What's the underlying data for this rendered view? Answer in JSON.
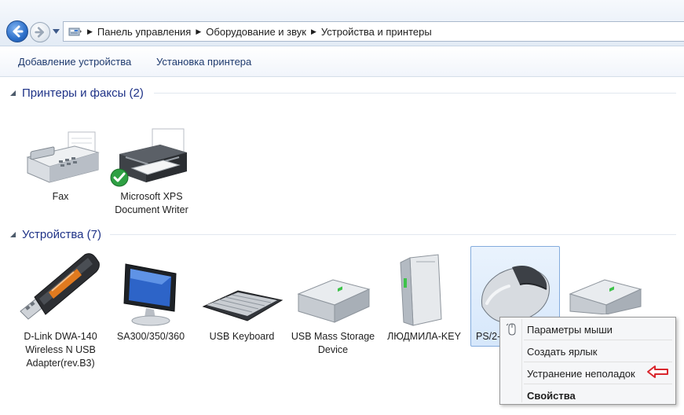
{
  "addressbar": {
    "breadcrumb": [
      {
        "label": "Панель управления"
      },
      {
        "label": "Оборудование и звук"
      },
      {
        "label": "Устройства и принтеры"
      }
    ]
  },
  "commandbar": {
    "add_device": "Добавление устройства",
    "add_printer": "Установка принтера"
  },
  "groups": {
    "printers": {
      "title": "Принтеры и факсы (2)",
      "items": [
        {
          "label": "Fax",
          "icon": "fax-icon"
        },
        {
          "label": "Microsoft XPS Document Writer",
          "icon": "printer-icon",
          "badge": "default-checkmark"
        }
      ]
    },
    "devices": {
      "title": "Устройства (7)",
      "items": [
        {
          "label": "D-Link DWA-140 Wireless N USB Adapter(rev.B3)",
          "icon": "usb-stick-icon"
        },
        {
          "label": "SA300/350/360",
          "icon": "monitor-icon"
        },
        {
          "label": "USB Keyboard",
          "icon": "keyboard-icon"
        },
        {
          "label": "USB Mass Storage Device",
          "icon": "drive-icon"
        },
        {
          "label": "ЛЮДМИЛА-KEY",
          "icon": "computer-icon"
        },
        {
          "label": "PS/2-",
          "icon": "mouse-icon",
          "selected": true
        },
        {
          "label": "",
          "icon": "drive-icon"
        }
      ]
    }
  },
  "context_menu": {
    "items": [
      {
        "label": "Параметры мыши",
        "icon": "mouse-settings-icon"
      },
      {
        "label": "Создать ярлык"
      },
      {
        "label": "Устранение неполадок",
        "annotation": "red-arrow"
      },
      {
        "label": "Свойства",
        "bold": true
      }
    ]
  },
  "colors": {
    "group_title": "#1e3287",
    "command_text": "#1e3a6e",
    "selection": "#d6e7fb",
    "annotation_arrow": "#d9272e"
  }
}
